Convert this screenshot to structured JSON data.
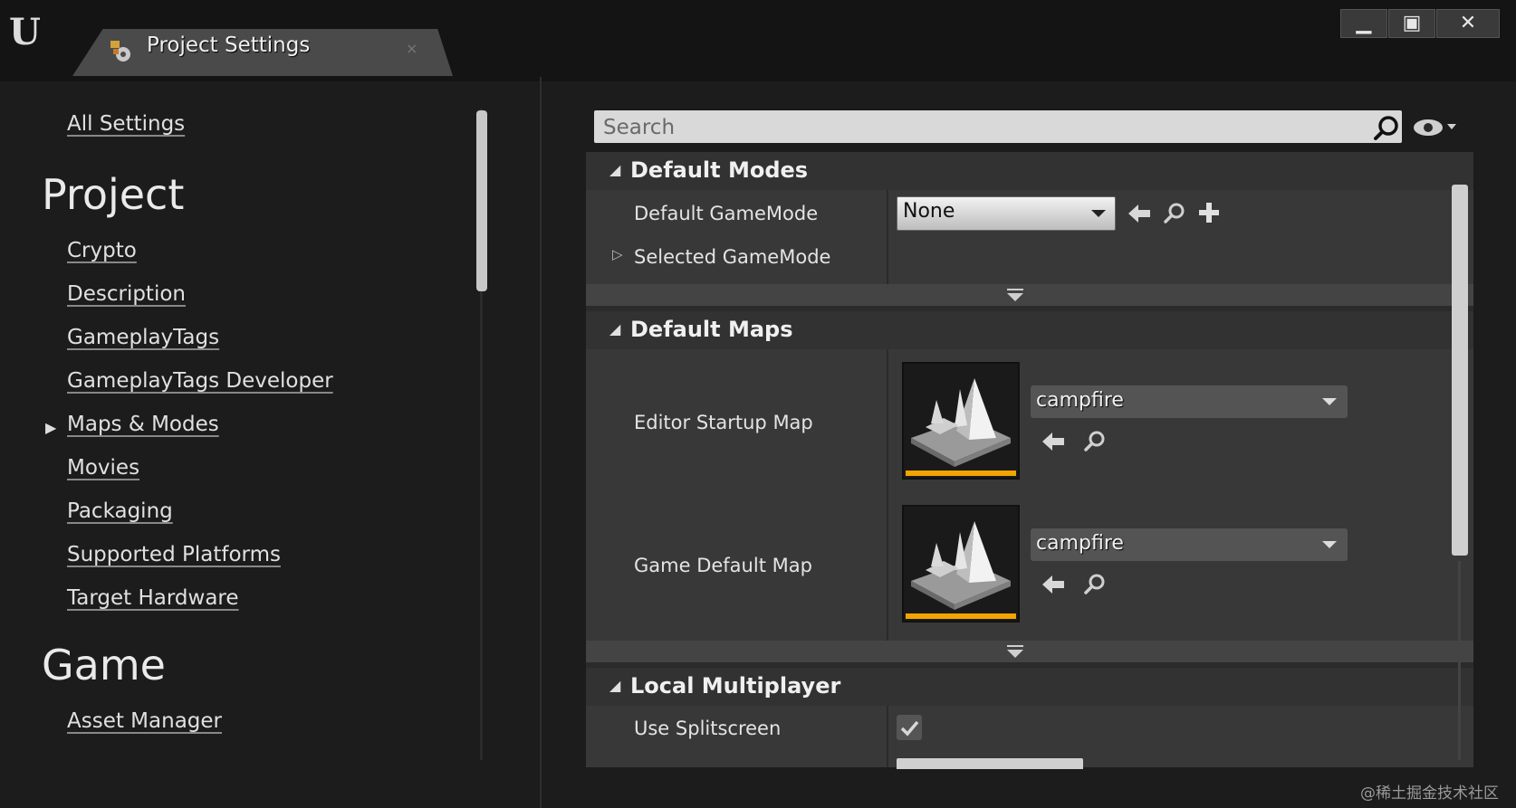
{
  "window": {
    "tab_title": "Project Settings",
    "tab_close": "×",
    "buttons": {
      "minimize": "▁",
      "maximize": "▣",
      "close": "✕"
    }
  },
  "sidebar": {
    "all_settings": "All Settings",
    "sections": [
      {
        "heading": "Project",
        "items": [
          {
            "label": "Crypto"
          },
          {
            "label": "Description"
          },
          {
            "label": "GameplayTags"
          },
          {
            "label": "GameplayTags Developer"
          },
          {
            "label": "Maps & Modes",
            "selected": true
          },
          {
            "label": "Movies"
          },
          {
            "label": "Packaging"
          },
          {
            "label": "Supported Platforms"
          },
          {
            "label": "Target Hardware"
          }
        ]
      },
      {
        "heading": "Game",
        "items": [
          {
            "label": "Asset Manager"
          }
        ]
      }
    ]
  },
  "search": {
    "placeholder": "Search"
  },
  "categories": {
    "default_modes": {
      "title": "Default Modes",
      "default_gamemode_label": "Default GameMode",
      "default_gamemode_value": "None",
      "selected_gamemode_label": "Selected GameMode"
    },
    "default_maps": {
      "title": "Default Maps",
      "editor_startup_label": "Editor Startup Map",
      "editor_startup_value": "campfire",
      "game_default_label": "Game Default Map",
      "game_default_value": "campfire"
    },
    "local_multiplayer": {
      "title": "Local Multiplayer",
      "use_splitscreen_label": "Use Splitscreen",
      "use_splitscreen_checked": true
    }
  },
  "colors": {
    "asset_bar": "#f2a400"
  },
  "watermark": "@稀土掘金技术社区"
}
